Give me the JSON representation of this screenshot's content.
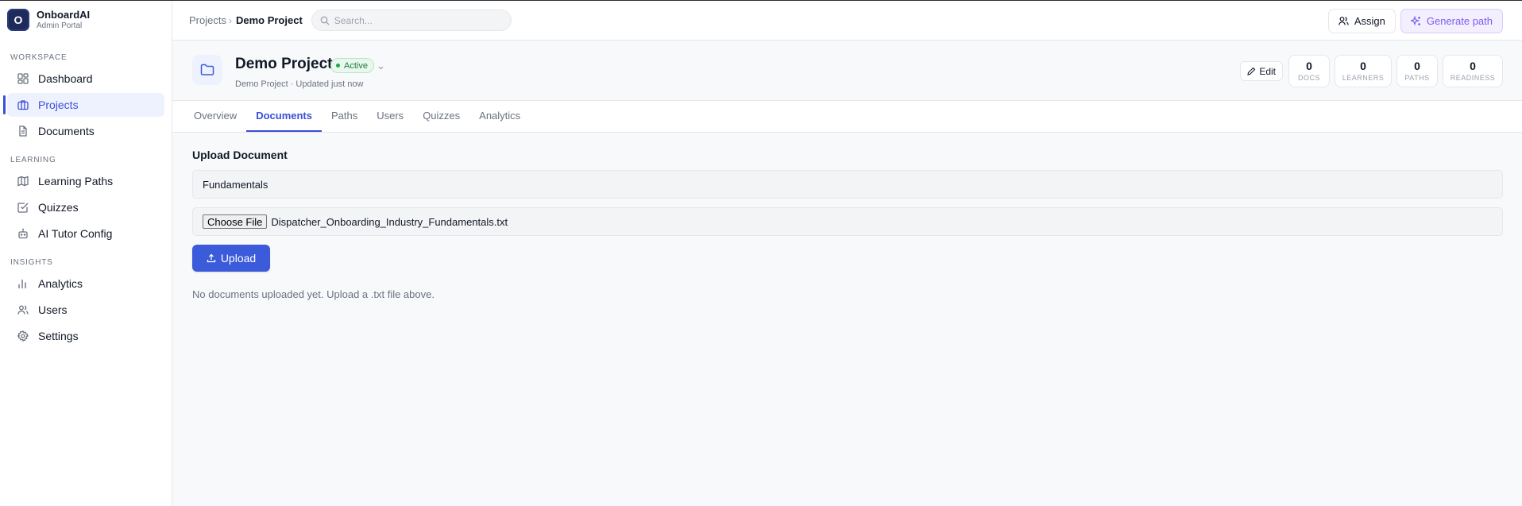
{
  "brand": {
    "logo_letter": "O",
    "name": "OnboardAI",
    "subtitle": "Admin Portal"
  },
  "sidebar": {
    "sections": [
      {
        "title": "WORKSPACE",
        "items": [
          {
            "label": "Dashboard",
            "icon": "dashboard-icon"
          },
          {
            "label": "Projects",
            "icon": "briefcase-icon",
            "active": true
          },
          {
            "label": "Documents",
            "icon": "document-icon"
          }
        ]
      },
      {
        "title": "LEARNING",
        "items": [
          {
            "label": "Learning Paths",
            "icon": "map-icon"
          },
          {
            "label": "Quizzes",
            "icon": "checkbox-icon"
          },
          {
            "label": "AI Tutor Config",
            "icon": "bot-icon"
          }
        ]
      },
      {
        "title": "INSIGHTS",
        "items": [
          {
            "label": "Analytics",
            "icon": "bar-chart-icon"
          },
          {
            "label": "Users",
            "icon": "users-icon"
          },
          {
            "label": "Settings",
            "icon": "gear-icon"
          }
        ]
      }
    ]
  },
  "topbar": {
    "breadcrumb_parent": "Projects",
    "breadcrumb_separator": "›",
    "breadcrumb_current": "Demo Project",
    "search_placeholder": "Search...",
    "assign_label": "Assign",
    "generate_label": "Generate path"
  },
  "project": {
    "title": "Demo Project",
    "status": "Active",
    "subtitle": "Demo Project · Updated just now",
    "edit_label": "Edit",
    "stats": [
      {
        "value": "0",
        "label": "DOCS"
      },
      {
        "value": "0",
        "label": "LEARNERS"
      },
      {
        "value": "0",
        "label": "PATHS"
      },
      {
        "value": "0",
        "label": "READINESS"
      }
    ]
  },
  "tabs": [
    {
      "label": "Overview"
    },
    {
      "label": "Documents",
      "active": true
    },
    {
      "label": "Paths"
    },
    {
      "label": "Users"
    },
    {
      "label": "Quizzes"
    },
    {
      "label": "Analytics"
    }
  ],
  "upload": {
    "section_title": "Upload Document",
    "title_value": "Fundamentals",
    "choose_file_label": "Choose File",
    "file_name": "Dispatcher_Onboarding_Industry_Fundamentals.txt",
    "upload_label": "Upload",
    "empty_message": "No documents uploaded yet. Upload a .txt file above."
  },
  "colors": {
    "accent": "#3b5bdb",
    "active_nav_bg": "#eef2ff",
    "status_green": "#22a44d",
    "generate_purple": "#7c5cf0"
  }
}
